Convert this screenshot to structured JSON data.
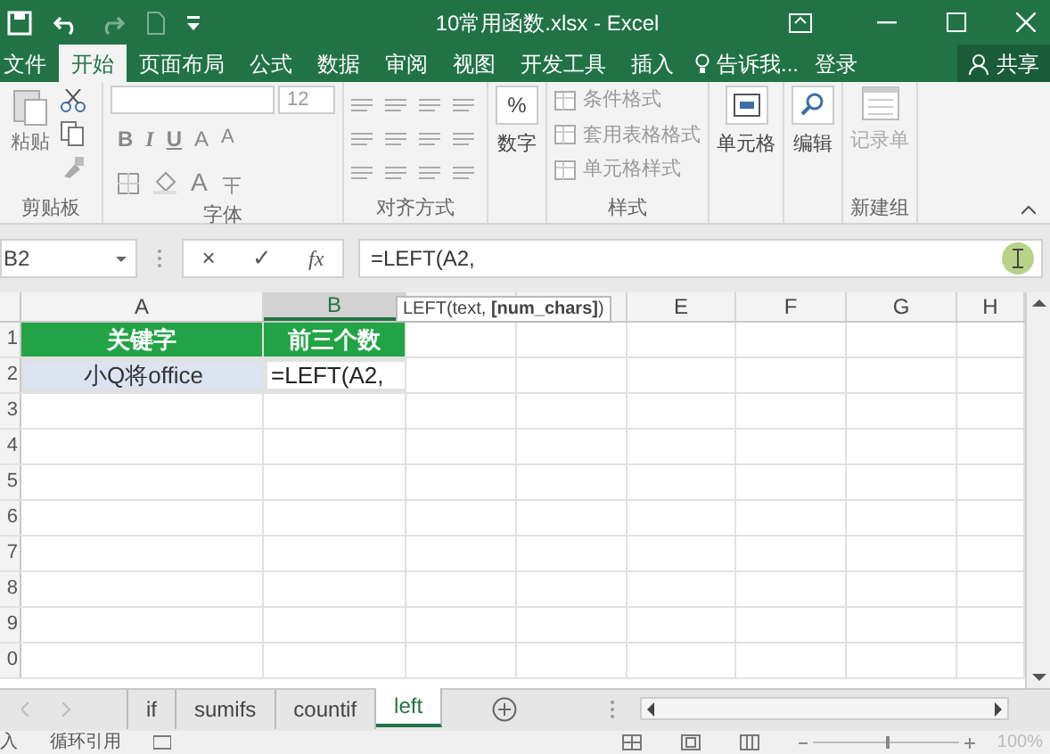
{
  "window": {
    "title": "10常用函数.xlsx - Excel"
  },
  "ribbon_tabs": [
    {
      "label": "文件",
      "selected": false
    },
    {
      "label": "开始",
      "selected": true
    },
    {
      "label": "页面布局",
      "selected": false
    },
    {
      "label": "公式",
      "selected": false
    },
    {
      "label": "数据",
      "selected": false
    },
    {
      "label": "审阅",
      "selected": false
    },
    {
      "label": "视图",
      "selected": false
    },
    {
      "label": "开发工具",
      "selected": false
    },
    {
      "label": "插入",
      "selected": false
    }
  ],
  "tell_me": "告诉我...",
  "sign_in": "登录",
  "share": "共享",
  "ribbon": {
    "clipboard": {
      "paste": "粘贴",
      "label": "剪贴板"
    },
    "font": {
      "size": "12",
      "buttons": [
        "B",
        "I",
        "U",
        "A",
        "A"
      ],
      "font_color": "A",
      "label": "字体"
    },
    "alignment": {
      "label": "对齐方式"
    },
    "number": {
      "symbol": "%",
      "label": "数字"
    },
    "styles": {
      "items": [
        "条件格式",
        "套用表格格式",
        "单元格样式"
      ],
      "label": "样式"
    },
    "cells": {
      "label": "单元格"
    },
    "editing": {
      "label": "编辑"
    },
    "custom": {
      "button": "记录单",
      "label": "新建组"
    }
  },
  "formula_bar": {
    "name_box": "B2",
    "buttons": [
      "×",
      "✓",
      "fx"
    ],
    "formula": "=LEFT(A2,"
  },
  "tooltip": "LEFT(text, **[num_chars]**)",
  "columns": [
    {
      "label": "A",
      "selected": false
    },
    {
      "label": "B",
      "selected": true
    },
    {
      "selected": false
    },
    {
      "selected": false
    },
    {
      "label": "E",
      "selected": false
    },
    {
      "label": "F",
      "selected": false
    },
    {
      "label": "G",
      "selected": false
    },
    {
      "label": "H",
      "selected": false
    }
  ],
  "rows": [
    {
      "label": "1",
      "cells": [
        {
          "kind": "header",
          "text": "关键字"
        },
        {
          "kind": "header",
          "text": "前三个数"
        }
      ]
    },
    {
      "label": "2",
      "cells": [
        {
          "kind": "ref",
          "text": "小Q将office"
        },
        {
          "kind": "editing",
          "text": "=LEFT(A2,"
        }
      ]
    },
    {
      "label": "3"
    },
    {
      "label": "4"
    },
    {
      "label": "5"
    },
    {
      "label": "6"
    },
    {
      "label": "7"
    },
    {
      "label": "8"
    },
    {
      "label": "9"
    },
    {
      "label": "0"
    }
  ],
  "sheet_tabs": [
    {
      "label": "if",
      "selected": false
    },
    {
      "label": "sumifs",
      "selected": false
    },
    {
      "label": "countif",
      "selected": false
    },
    {
      "label": "left",
      "selected": true
    }
  ],
  "status_bar": {
    "mode": "入",
    "circular": "循环引用",
    "zoom_slider": {
      "level": 0.5
    },
    "zoom": "100%"
  }
}
